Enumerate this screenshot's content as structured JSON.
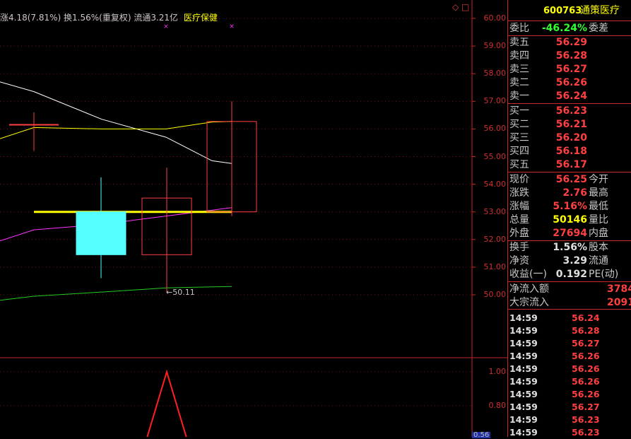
{
  "header": {
    "stat_text": "涨4.18(7.81%) 换1.56%(重复权) 流通3.21亿",
    "sector": "医疗保健",
    "icon_diamond": "diamond-icon",
    "icon_square": "square-icon"
  },
  "price_axis": {
    "ticks": [
      "60.00",
      "59.00",
      "58.00",
      "57.00",
      "56.00",
      "55.00",
      "54.00",
      "53.00",
      "52.00",
      "51.00",
      "50.00"
    ]
  },
  "indicator_axis": {
    "ticks": [
      "1.00",
      "0.80"
    ],
    "partial_tick": "0.56"
  },
  "low_marker_label": "←50.11",
  "chart_data": {
    "type": "candlestick",
    "title": "",
    "ylim": [
      49.5,
      60.5
    ],
    "candles": [
      {
        "open": 56.15,
        "close": 56.15,
        "high": 56.6,
        "low": 55.2,
        "color": "#ff4040",
        "fill": "none"
      },
      {
        "open": 53.0,
        "close": 51.45,
        "high": 54.25,
        "low": 50.6,
        "color": "#54ffff",
        "fill": "#54ffff"
      },
      {
        "open": 51.45,
        "close": 53.5,
        "high": 54.6,
        "low": 50.1,
        "color": "#ff4040",
        "fill": "none"
      },
      {
        "open": 53.0,
        "close": 56.27,
        "high": 57.0,
        "low": 52.85,
        "color": "#ff4040",
        "fill": "none"
      }
    ],
    "ma_lines": [
      {
        "color": "#ffffff",
        "values": [
          57.7,
          57.35,
          56.35,
          55.7,
          54.85,
          54.75
        ]
      },
      {
        "color": "#ffff00",
        "values": [
          55.65,
          56.05,
          56.0,
          56.0,
          56.25,
          56.27
        ]
      },
      {
        "color": "#ff33ff",
        "values": [
          51.95,
          52.35,
          52.55,
          52.85,
          53.15
        ]
      },
      {
        "color": "#22cc22",
        "values": [
          49.8,
          49.95,
          50.1,
          50.25,
          50.3
        ]
      }
    ],
    "reference_line": 53.0,
    "indicator": {
      "values": [
        0.5,
        1.0,
        0.5
      ]
    }
  },
  "quote_panel": {
    "code": "600763",
    "name": "通策医疗",
    "ratio_label": "委比",
    "ratio_value": "-46.24%",
    "diff_label": "委差",
    "sells": [
      {
        "label": "卖五",
        "price": "56.29"
      },
      {
        "label": "卖四",
        "price": "56.28"
      },
      {
        "label": "卖三",
        "price": "56.27"
      },
      {
        "label": "卖二",
        "price": "56.26"
      },
      {
        "label": "卖一",
        "price": "56.24"
      }
    ],
    "buys": [
      {
        "label": "买一",
        "price": "56.23"
      },
      {
        "label": "买二",
        "price": "56.21"
      },
      {
        "label": "买三",
        "price": "56.20"
      },
      {
        "label": "买四",
        "price": "56.18"
      },
      {
        "label": "买五",
        "price": "56.17"
      }
    ],
    "stats1": [
      {
        "label": "现价",
        "value": "56.25",
        "label2": "今开",
        "color": "#ff4040"
      },
      {
        "label": "涨跌",
        "value": "2.76",
        "label2": "最高",
        "color": "#ff4040"
      },
      {
        "label": "涨幅",
        "value": "5.16%",
        "label2": "最低",
        "color": "#ff4040"
      },
      {
        "label": "总量",
        "value": "50146",
        "label2": "量比",
        "color": "#ffff00"
      },
      {
        "label": "外盘",
        "value": "27694",
        "label2": "内盘",
        "color": "#ff4040"
      }
    ],
    "stats2": [
      {
        "label": "换手",
        "value": "1.56%",
        "label2": "股本",
        "color": "#e0e0e0"
      },
      {
        "label": "净资",
        "value": "3.29",
        "label2": "流通",
        "color": "#e0e0e0"
      },
      {
        "label": "收益(一)",
        "value": "0.192",
        "label2": "PE(动)",
        "color": "#e0e0e0"
      }
    ],
    "flows": [
      {
        "label": "净流入额",
        "value": "3784"
      },
      {
        "label": "大宗流入",
        "value": "2091"
      }
    ],
    "ticks": [
      {
        "time": "14:59",
        "price": "56.24"
      },
      {
        "time": "14:59",
        "price": "56.28"
      },
      {
        "time": "14:59",
        "price": "56.27"
      },
      {
        "time": "14:59",
        "price": "56.26"
      },
      {
        "time": "14:59",
        "price": "56.26"
      },
      {
        "time": "14:59",
        "price": "56.26"
      },
      {
        "time": "14:59",
        "price": "56.26"
      },
      {
        "time": "14:59",
        "price": "56.27"
      },
      {
        "time": "14:59",
        "price": "56.23"
      },
      {
        "time": "14:59",
        "price": "56.23"
      }
    ]
  }
}
